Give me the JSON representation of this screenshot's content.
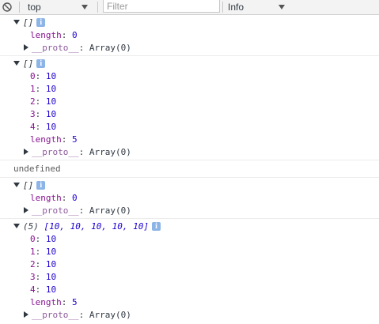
{
  "toolbar": {
    "context": "top",
    "filter_placeholder": "Filter",
    "level": "Info"
  },
  "messages": [
    {
      "header": "[]",
      "rows": [],
      "length_key": "length",
      "length_val": "0",
      "proto_key": "__proto__",
      "proto_val": "Array(0)"
    },
    {
      "header": "[]",
      "rows": [
        {
          "k": "0",
          "v": "10"
        },
        {
          "k": "1",
          "v": "10"
        },
        {
          "k": "2",
          "v": "10"
        },
        {
          "k": "3",
          "v": "10"
        },
        {
          "k": "4",
          "v": "10"
        }
      ],
      "length_key": "length",
      "length_val": "5",
      "proto_key": "__proto__",
      "proto_val": "Array(0)"
    },
    {
      "undefined_text": "undefined"
    },
    {
      "header": "[]",
      "rows": [],
      "length_key": "length",
      "length_val": "0",
      "proto_key": "__proto__",
      "proto_val": "Array(0)"
    },
    {
      "header_count": "(5)",
      "header": "[10, 10, 10, 10, 10]",
      "rows": [
        {
          "k": "0",
          "v": "10"
        },
        {
          "k": "1",
          "v": "10"
        },
        {
          "k": "2",
          "v": "10"
        },
        {
          "k": "3",
          "v": "10"
        },
        {
          "k": "4",
          "v": "10"
        }
      ],
      "length_key": "length",
      "length_val": "5",
      "proto_key": "__proto__",
      "proto_val": "Array(0)"
    }
  ],
  "colon": ":",
  "info_badge": "i"
}
